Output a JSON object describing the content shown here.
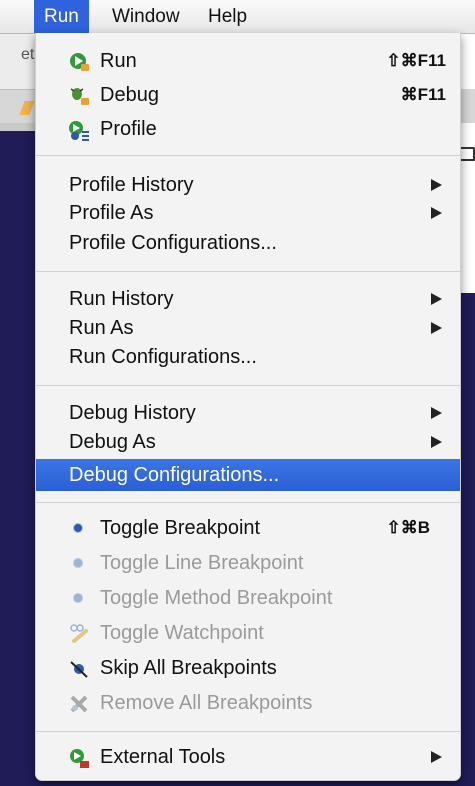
{
  "menubar": {
    "run": "Run",
    "window": "Window",
    "help": "Help"
  },
  "background": {
    "fragment_text": "et"
  },
  "menu": {
    "items": [
      {
        "label": "Run",
        "shortcut": "⇧⌘F11",
        "icon": "run-icon",
        "disabled": false
      },
      {
        "label": "Debug",
        "shortcut": "⌘F11",
        "icon": "debug-icon",
        "disabled": false
      },
      {
        "label": "Profile",
        "shortcut": "",
        "icon": "profile-icon",
        "disabled": false
      },
      {
        "label": "Profile History",
        "submenu": true
      },
      {
        "label": "Profile As",
        "submenu": true
      },
      {
        "label": "Profile Configurations...",
        "submenu": false
      },
      {
        "label": "Run History",
        "submenu": true
      },
      {
        "label": "Run As",
        "submenu": true
      },
      {
        "label": "Run Configurations...",
        "submenu": false
      },
      {
        "label": "Debug History",
        "submenu": true
      },
      {
        "label": "Debug As",
        "submenu": true
      },
      {
        "label": "Debug Configurations...",
        "submenu": false,
        "highlighted": true
      },
      {
        "label": "Toggle Breakpoint",
        "shortcut": "⇧⌘B",
        "icon": "breakpoint-dot-icon",
        "disabled": false
      },
      {
        "label": "Toggle Line Breakpoint",
        "icon": "breakpoint-dot-icon",
        "disabled": true
      },
      {
        "label": "Toggle Method Breakpoint",
        "icon": "breakpoint-dot-icon",
        "disabled": true
      },
      {
        "label": "Toggle Watchpoint",
        "icon": "watchpoint-icon",
        "disabled": true
      },
      {
        "label": "Skip All Breakpoints",
        "icon": "skip-breakpoints-icon",
        "disabled": false
      },
      {
        "label": "Remove All Breakpoints",
        "icon": "remove-breakpoints-icon",
        "disabled": true
      },
      {
        "label": "External Tools",
        "icon": "external-tools-icon",
        "submenu": true
      }
    ]
  },
  "colors": {
    "highlight": "#2f62dc",
    "desktop": "#1f1c57"
  }
}
